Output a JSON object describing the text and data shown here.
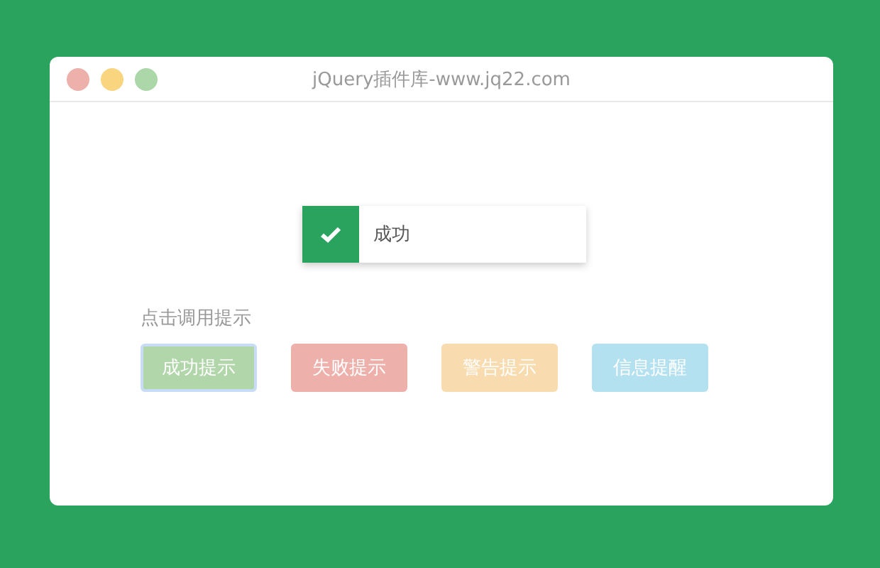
{
  "window": {
    "title": "jQuery插件库-www.jq22.com",
    "controls": [
      {
        "color": "#eeb0ab"
      },
      {
        "color": "#f8d57e"
      },
      {
        "color": "#acd7a8"
      }
    ]
  },
  "toast": {
    "kind": "success",
    "message": "成功"
  },
  "prompt": "点击调用提示",
  "buttons": [
    {
      "label": "成功提示",
      "color": "#b0d6a9",
      "focused": true
    },
    {
      "label": "失败提示",
      "color": "#edb0ab",
      "focused": false
    },
    {
      "label": "警告提示",
      "color": "#f8dbae",
      "focused": false
    },
    {
      "label": "信息提醒",
      "color": "#b4e1f0",
      "focused": false
    }
  ]
}
